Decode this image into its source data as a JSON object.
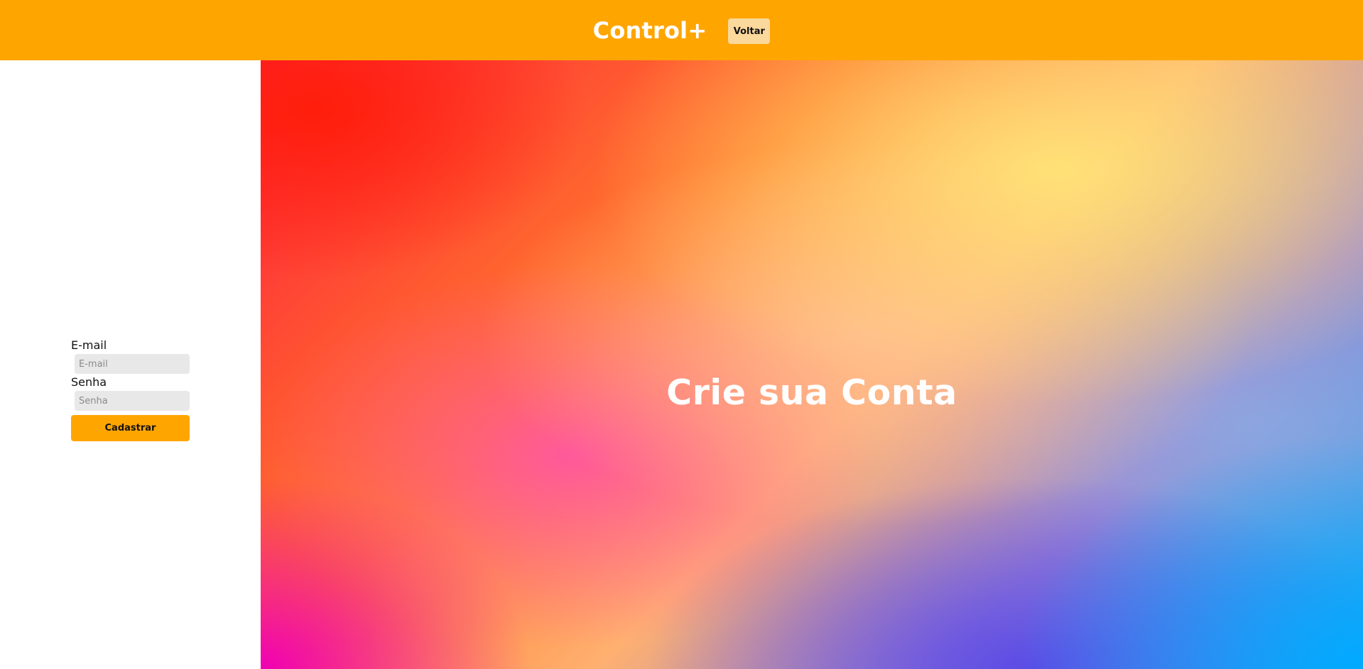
{
  "header": {
    "brand": "Control+",
    "back_label": "Voltar"
  },
  "form": {
    "email_label": "E-mail",
    "email_placeholder": "E-mail",
    "password_label": "Senha",
    "password_placeholder": "Senha",
    "submit_label": "Cadastrar"
  },
  "hero": {
    "title": "Crie sua Conta"
  },
  "colors": {
    "accent": "#FFA500",
    "back_button": "#FBD89B",
    "input_bg": "#E8E8E8"
  }
}
